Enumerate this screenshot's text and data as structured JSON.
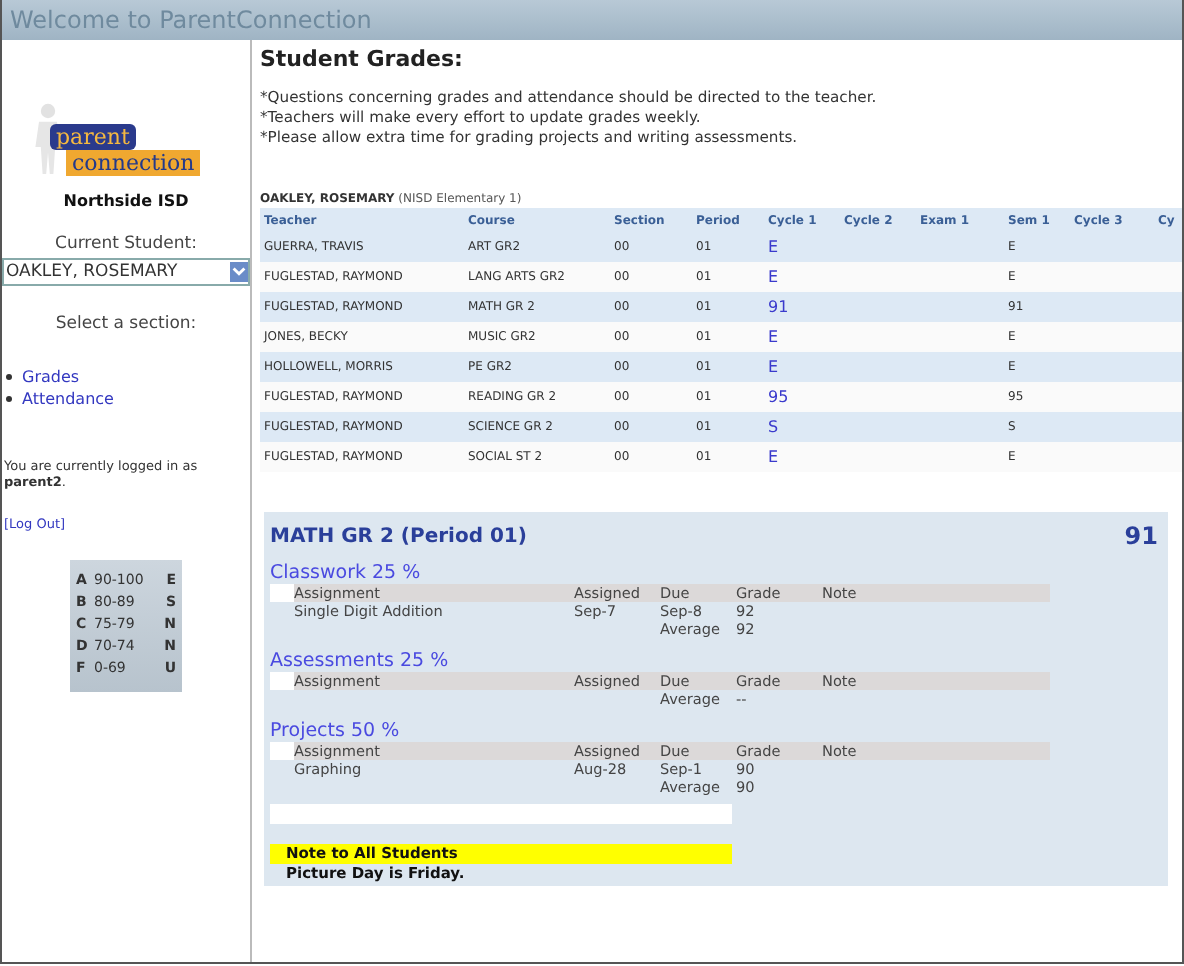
{
  "window": {
    "title": "Welcome to ParentConnection"
  },
  "sidebar": {
    "logo": {
      "line_1": "parent",
      "line_2": "connection"
    },
    "district": "Northside ISD",
    "student_label": "Current Student:",
    "student_select": {
      "value": "OAKLEY, ROSEMARY"
    },
    "section_label": "Select a section:",
    "links": [
      {
        "label": "Grades",
        "selected": false
      },
      {
        "label": "Attendance",
        "selected": false
      }
    ],
    "login_note": "You are currently logged in as **parent2**.",
    "logout": "[Log Out]",
    "grade_key": [
      {
        "letter": "A",
        "range": "90-100",
        "mark": "E"
      },
      {
        "letter": "B",
        "range": "80-89",
        "mark": "S"
      },
      {
        "letter": "C",
        "range": "75-79",
        "mark": "N"
      },
      {
        "letter": "D",
        "range": "70-74",
        "mark": "N"
      },
      {
        "letter": "F",
        "range": "0-69",
        "mark": "U"
      }
    ]
  },
  "main": {
    "heading": "Student Grades:",
    "notes": [
      "*Questions concerning grades and attendance should be directed to the teacher.",
      "*Teachers will make every effort to update grades weekly.",
      "*Please allow extra time for grading projects and writing assessments."
    ],
    "student_name": "OAKLEY, ROSEMARY",
    "school": "(NISD Elementary 1)",
    "table": {
      "columns": [
        "Teacher",
        "Course",
        "Section",
        "Period",
        "Cycle 1",
        "Cycle 2",
        "Exam 1",
        "Sem 1",
        "Cycle 3",
        "Cy"
      ],
      "rows": [
        {
          "teacher": "GUERRA, TRAVIS",
          "course": "ART GR2",
          "section": "00",
          "period": "01",
          "cycle_1": "E",
          "sem_1": "E"
        },
        {
          "teacher": "FUGLESTAD, RAYMOND",
          "course": "LANG ARTS GR2",
          "section": "00",
          "period": "01",
          "cycle_1": "E",
          "sem_1": "E"
        },
        {
          "teacher": "FUGLESTAD, RAYMOND",
          "course": "MATH GR 2",
          "section": "00",
          "period": "01",
          "cycle_1": "91",
          "sem_1": "91"
        },
        {
          "teacher": "JONES, BECKY",
          "course": "MUSIC GR2",
          "section": "00",
          "period": "01",
          "cycle_1": "E",
          "sem_1": "E"
        },
        {
          "teacher": "HOLLOWELL, MORRIS",
          "course": "PE GR2",
          "section": "00",
          "period": "01",
          "cycle_1": "E",
          "sem_1": "E"
        },
        {
          "teacher": "FUGLESTAD, RAYMOND",
          "course": "READING GR 2",
          "section": "00",
          "period": "01",
          "cycle_1": "95",
          "sem_1": "95"
        },
        {
          "teacher": "FUGLESTAD, RAYMOND",
          "course": "SCIENCE GR 2",
          "section": "00",
          "period": "01",
          "cycle_1": "S",
          "sem_1": "S"
        },
        {
          "teacher": "FUGLESTAD, RAYMOND",
          "course": "SOCIAL ST 2",
          "section": "00",
          "period": "01",
          "cycle_1": "E",
          "sem_1": "E"
        }
      ]
    },
    "detail": {
      "title": "MATH GR 2 (Period 01)",
      "grade": "91",
      "categories": [
        {
          "name": "Classwork 25 %",
          "columns": [
            "Assignment",
            "Assigned",
            "Due",
            "Grade",
            "Note"
          ],
          "assignments": [
            {
              "name": "Single Digit Addition",
              "assigned": "Sep-7",
              "due": "Sep-8",
              "grade": "92"
            }
          ],
          "average_label": "Average",
          "average": "92"
        },
        {
          "name": "Assessments 25 %",
          "columns": [
            "Assignment",
            "Assigned",
            "Due",
            "Grade",
            "Note"
          ],
          "average_label": "Average",
          "average": "--"
        },
        {
          "name": "Projects 50 %",
          "columns": [
            "Assignment",
            "Assigned",
            "Due",
            "Grade",
            "Note"
          ],
          "assignments": [
            {
              "name": "Graphing",
              "assigned": "Aug-28",
              "due": "Sep-1",
              "grade": "90"
            }
          ],
          "average_label": "Average",
          "average": "90"
        }
      ],
      "note_title": "Note to All Students",
      "note_text": "Picture Day is Friday."
    }
  }
}
